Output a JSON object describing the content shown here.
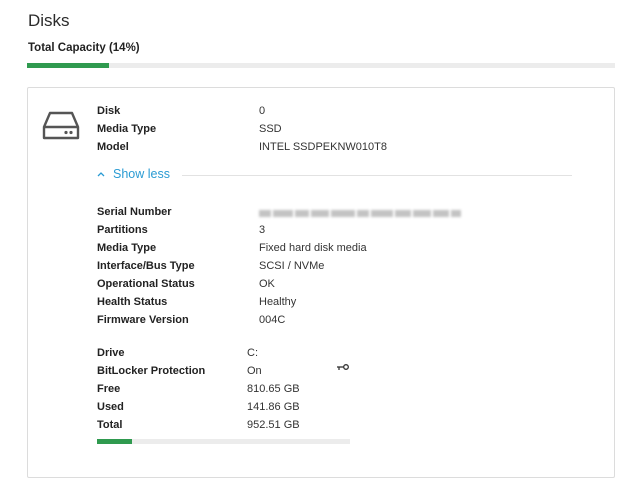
{
  "page": {
    "title": "Disks"
  },
  "total_capacity": {
    "label": "Total Capacity (14%)",
    "percent": 14
  },
  "disk": {
    "icon": "hard-drive-icon",
    "summary": [
      {
        "label": "Disk",
        "value": "0"
      },
      {
        "label": "Media Type",
        "value": "SSD"
      },
      {
        "label": "Model",
        "value": "INTEL SSDPEKNW010T8"
      }
    ],
    "toggle_label": "Show less",
    "toggle_icon": "chevron-up-icon",
    "details": [
      {
        "label": "Serial Number",
        "value": "",
        "redacted": true
      },
      {
        "label": "Partitions",
        "value": "3"
      },
      {
        "label": "Media Type",
        "value": "Fixed hard disk media"
      },
      {
        "label": "Interface/Bus Type",
        "value": "SCSI / NVMe"
      },
      {
        "label": "Operational Status",
        "value": "OK"
      },
      {
        "label": "Health Status",
        "value": "Healthy"
      },
      {
        "label": "Firmware Version",
        "value": "004C"
      }
    ],
    "volume": [
      {
        "label": "Drive",
        "value": "C:"
      },
      {
        "label": "BitLocker Protection",
        "value": "On",
        "icon": "key-icon"
      },
      {
        "label": "Free",
        "value": "810.65 GB"
      },
      {
        "label": "Used",
        "value": "141.86 GB"
      },
      {
        "label": "Total",
        "value": "952.51 GB"
      }
    ],
    "usage_percent": 14
  },
  "colors": {
    "accent_link": "#2a9bd3",
    "usage_bar": "#2f9a4f",
    "track": "#ececec"
  }
}
